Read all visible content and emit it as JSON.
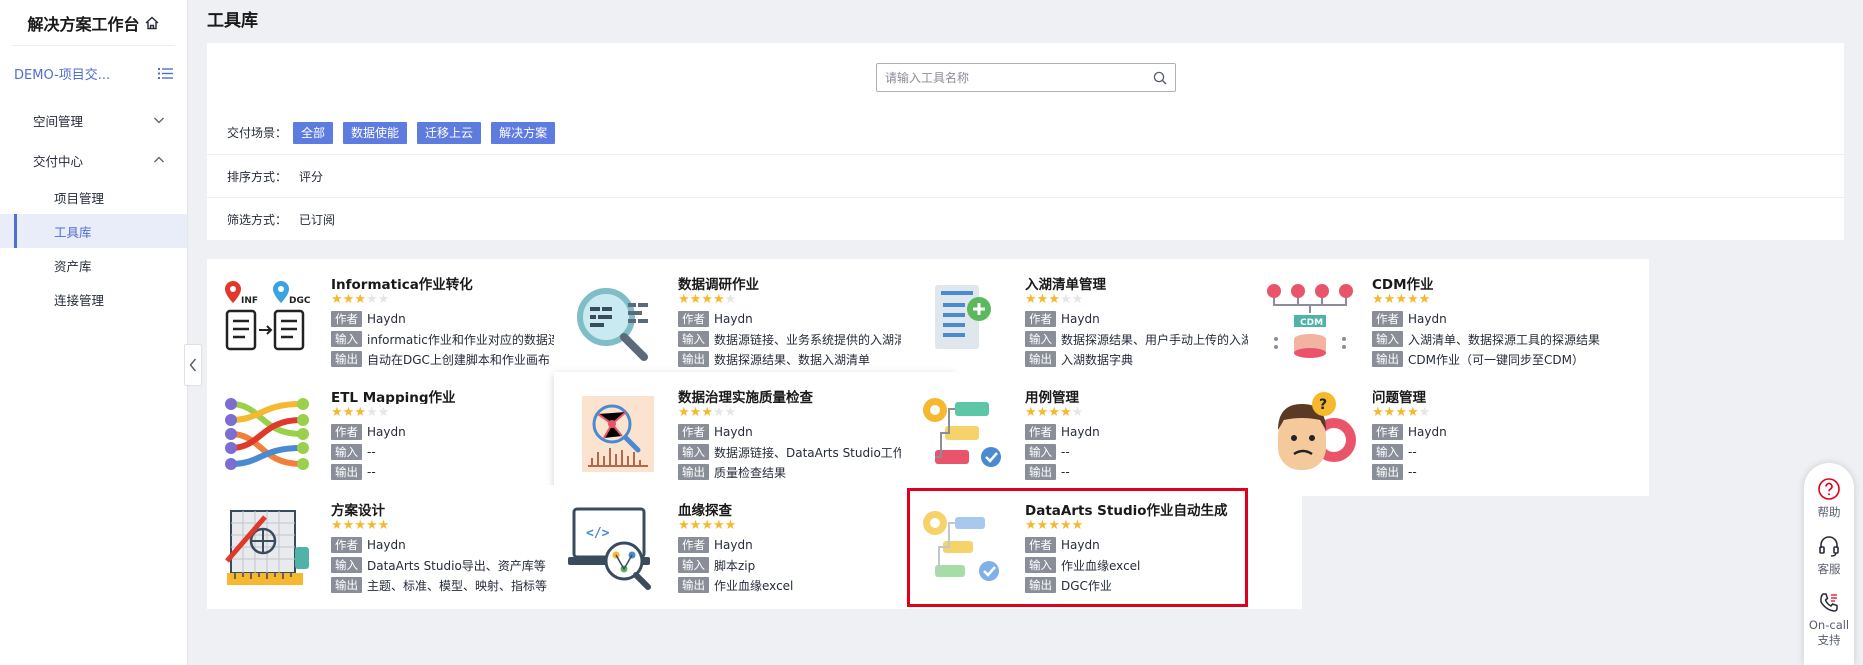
{
  "sidebar": {
    "brand": "解决方案工作台",
    "project": "DEMO-项目交...",
    "groups": [
      {
        "label": "空间管理"
      },
      {
        "label": "交付中心"
      }
    ],
    "items": [
      {
        "label": "项目管理"
      },
      {
        "label": "工具库"
      },
      {
        "label": "资产库"
      },
      {
        "label": "连接管理"
      }
    ]
  },
  "page": {
    "title": "工具库"
  },
  "search": {
    "placeholder": "请输入工具名称"
  },
  "filters": {
    "scene_label": "交付场景：",
    "scene_tags": [
      "全部",
      "数据使能",
      "迁移上云",
      "解决方案"
    ],
    "sort_label": "排序方式：",
    "sort_value": "评分",
    "filter_label": "筛选方式：",
    "filter_value": "已订阅"
  },
  "meta_labels": {
    "author": "作者",
    "input": "输入",
    "output": "输出"
  },
  "cards": [
    {
      "title": "Informatica作业转化",
      "rating": 3,
      "author": "Haydn",
      "input": "informatic作业和作业对应的数据连接信息",
      "output": "自动在DGC上创建脚本和作业画布",
      "icon": "informatica-icon"
    },
    {
      "title": "数据调研作业",
      "rating": 4,
      "author": "Haydn",
      "input": "数据源链接、业务系统提供的入湖清单...",
      "output": "数据探源结果、数据入湖清单",
      "icon": "data-research-icon"
    },
    {
      "title": "入湖清单管理",
      "rating": 3,
      "author": "Haydn",
      "input": "数据探源结果、用户手动上传的入湖清单",
      "output": "入湖数据字典",
      "icon": "lake-list-icon"
    },
    {
      "title": "CDM作业",
      "rating": 5,
      "author": "Haydn",
      "input": "入湖清单、数据探源工具的探源结果",
      "output": "CDM作业（可一键同步至CDM）",
      "icon": "cdm-icon"
    },
    {
      "title": "ETL Mapping作业",
      "rating": 3,
      "author": "Haydn",
      "input": "--",
      "output": "--",
      "icon": "etl-mapping-icon"
    },
    {
      "title": "数据治理实施质量检查",
      "rating": 3,
      "author": "Haydn",
      "input": "数据源链接、DataArts Studio工作空间",
      "output": "质量检查结果",
      "icon": "quality-check-icon"
    },
    {
      "title": "用例管理",
      "rating": 4,
      "author": "Haydn",
      "input": "--",
      "output": "--",
      "icon": "use-case-icon"
    },
    {
      "title": "问题管理",
      "rating": 4,
      "author": "Haydn",
      "input": "--",
      "output": "--",
      "icon": "issue-icon"
    },
    {
      "title": "方案设计",
      "rating": 5,
      "author": "Haydn",
      "input": "DataArts Studio导出、资产库等",
      "output": "主题、标准、模型、映射、指标等",
      "icon": "design-icon"
    },
    {
      "title": "血缘探查",
      "rating": 5,
      "author": "Haydn",
      "input": "脚本zip",
      "output": "作业血缘excel",
      "icon": "lineage-icon"
    },
    {
      "title": "DataArts Studio作业自动生成",
      "rating": 5,
      "author": "Haydn",
      "input": "作业血缘excel",
      "output": "DGC作业",
      "icon": "auto-gen-icon"
    }
  ],
  "float_bar": {
    "help": "帮助",
    "service": "客服",
    "oncall_1": "On-call",
    "oncall_2": "支持"
  },
  "colors": {
    "accent": "#5e7ce0",
    "star": "#f5b82e",
    "highlight": "#e0001b"
  }
}
